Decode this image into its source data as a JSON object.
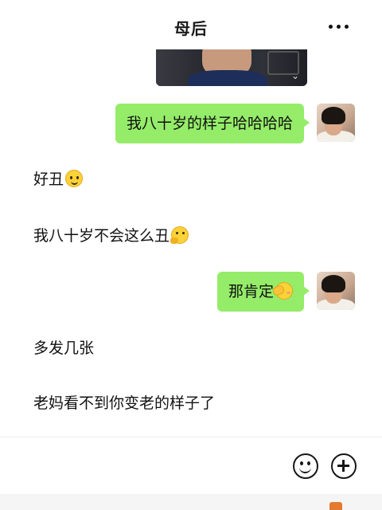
{
  "header": {
    "title": "母后",
    "more_icon": "more-dots-icon"
  },
  "messages": [
    {
      "side": "out",
      "type": "image",
      "description_icon": "photo-message"
    },
    {
      "side": "out",
      "type": "text",
      "text": "我八十岁的样子哈哈哈哈"
    },
    {
      "side": "in",
      "type": "text",
      "text": "好丑",
      "emoji": "smile-emoji"
    },
    {
      "side": "in",
      "type": "text",
      "text": "我八十岁不会这么丑",
      "emoji": "thinking-emoji"
    },
    {
      "side": "out",
      "type": "text",
      "text": "那肯定",
      "emoji": "shy-emoji"
    },
    {
      "side": "in",
      "type": "text",
      "text": "多发几张"
    },
    {
      "side": "in",
      "type": "text",
      "text": "老妈看不到你变老的样子了"
    }
  ],
  "input_bar": {
    "emoji_icon": "emoji-smile-icon",
    "plus_icon": "plus-circle-icon"
  },
  "colors": {
    "outgoing_bubble": "#95ec69",
    "background": "#ffffff"
  }
}
